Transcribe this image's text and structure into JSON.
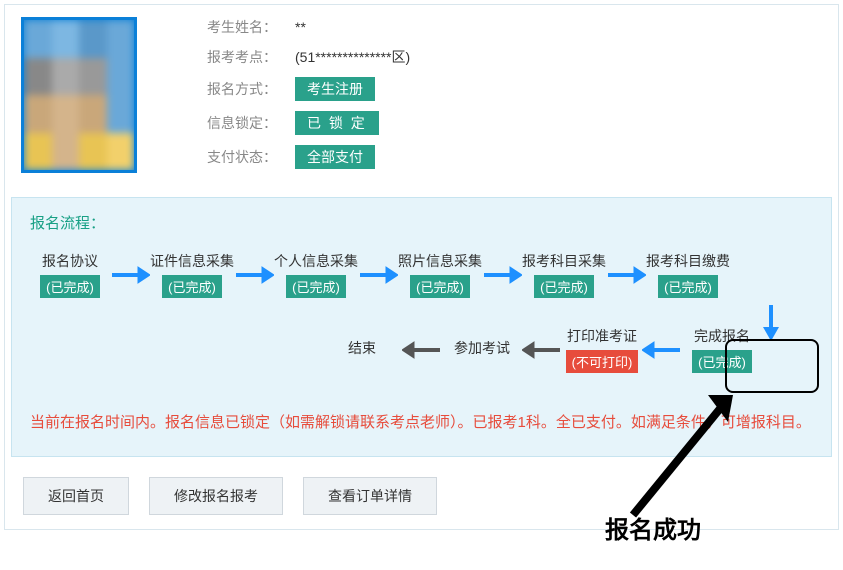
{
  "info": {
    "labels": {
      "name": "考生姓名：",
      "site": "报考考点：",
      "method": "报名方式：",
      "lock": "信息锁定：",
      "pay": "支付状态："
    },
    "values": {
      "name": "**",
      "site": "(51**************区)",
      "method_badge": "考生注册",
      "lock_badge": "已 锁 定",
      "pay_badge": "全部支付"
    }
  },
  "flow": {
    "title": "报名流程：",
    "steps": {
      "agreement": {
        "name": "报名协议",
        "status": "(已完成)"
      },
      "id_collect": {
        "name": "证件信息采集",
        "status": "(已完成)"
      },
      "personal": {
        "name": "个人信息采集",
        "status": "(已完成)"
      },
      "photo": {
        "name": "照片信息采集",
        "status": "(已完成)"
      },
      "subject": {
        "name": "报考科目采集",
        "status": "(已完成)"
      },
      "fee": {
        "name": "报考科目缴费",
        "status": "(已完成)"
      },
      "finish": {
        "name": "完成报名",
        "status": "(已完成)"
      },
      "print": {
        "name": "打印准考证",
        "status": "(不可打印)"
      },
      "exam": {
        "name": "参加考试",
        "status": ""
      },
      "end": {
        "name": "结束",
        "status": ""
      }
    }
  },
  "status_message": "当前在报名时间内。报名信息已锁定（如需解锁请联系考点老师）。已报考1科。全已支付。如满足条件，可增报科目。",
  "buttons": {
    "home": "返回首页",
    "modify": "修改报名报考",
    "orders": "查看订单详情"
  },
  "callout_text": "报名成功"
}
